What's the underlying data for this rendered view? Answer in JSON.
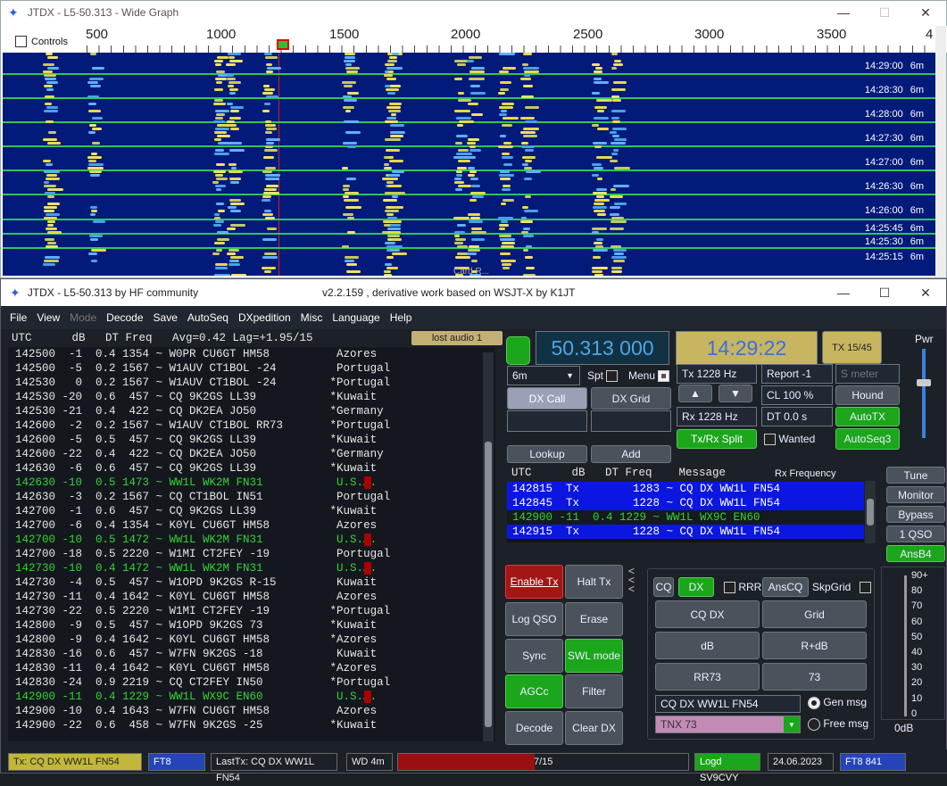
{
  "wide_graph": {
    "title": "JTDX - L5-50.313 - Wide Graph",
    "controls_label": "Controls",
    "ticks": [
      "500",
      "1000",
      "1500",
      "2000",
      "2500",
      "3000",
      "3500",
      "4"
    ],
    "time_labels": [
      {
        "t": "14:29:00",
        "b": "6m"
      },
      {
        "t": "14:28:30",
        "b": "6m"
      },
      {
        "t": "14:28:00",
        "b": "6m"
      },
      {
        "t": "14:27:30",
        "b": "6m"
      },
      {
        "t": "14:27:00",
        "b": "6m"
      },
      {
        "t": "14:26:30",
        "b": "6m"
      },
      {
        "t": "14:26:00",
        "b": "6m"
      },
      {
        "t": "14:25:45",
        "b": "6m"
      },
      {
        "t": "14:25:30",
        "b": "6m"
      },
      {
        "t": "14:25:15",
        "b": "6m"
      }
    ],
    "overlay_text": "Card R..."
  },
  "main": {
    "title": "JTDX - L5-50.313   by HF community",
    "subtitle": "v2.2.159 , derivative work based on WSJT-X by K1JT",
    "menu": [
      "File",
      "View",
      "Mode",
      "Decode",
      "Save",
      "AutoSeq",
      "DXpedition",
      "Misc",
      "Language",
      "Help"
    ],
    "header": "UTC      dB   DT Freq   Avg=0.42 Lag=+1.95/15",
    "lost_audio": "lost audio 1",
    "decodes": [
      {
        "t": "142500  -1  0.4 1354 ~ W0PR CU6GT HM58          Azores",
        "g": false,
        "f": false
      },
      {
        "t": "142500  -5  0.2 1567 ~ W1AUV CT1BOL -24         Portugal",
        "g": false,
        "f": false
      },
      {
        "t": "142530   0  0.2 1567 ~ W1AUV CT1BOL -24        *Portugal",
        "g": false,
        "f": false
      },
      {
        "t": "142530 -20  0.6  457 ~ CQ 9K2GS LL39           *Kuwait",
        "g": false,
        "f": false
      },
      {
        "t": "142530 -21  0.4  422 ~ CQ DK2EA JO50           *Germany",
        "g": false,
        "f": false
      },
      {
        "t": "142600  -2  0.2 1567 ~ W1AUV CT1BOL RR73       *Portugal",
        "g": false,
        "f": false
      },
      {
        "t": "142600  -5  0.5  457 ~ CQ 9K2GS LL39           *Kuwait",
        "g": false,
        "f": false
      },
      {
        "t": "142600 -22  0.4  422 ~ CQ DK2EA JO50           *Germany",
        "g": false,
        "f": false
      },
      {
        "t": "142630  -6  0.6  457 ~ CQ 9K2GS LL39           *Kuwait",
        "g": false,
        "f": false
      },
      {
        "t": "142630 -10  0.5 1473 ~ WW1L WK2M FN31           U.S.A.",
        "g": true,
        "f": true
      },
      {
        "t": "142630  -3  0.2 1567 ~ CQ CT1BOL IN51           Portugal",
        "g": false,
        "f": false
      },
      {
        "t": "142700  -1  0.6  457 ~ CQ 9K2GS LL39           *Kuwait",
        "g": false,
        "f": false
      },
      {
        "t": "142700  -6  0.4 1354 ~ K0YL CU6GT HM58          Azores",
        "g": false,
        "f": false
      },
      {
        "t": "142700 -10  0.5 1472 ~ WW1L WK2M FN31           U.S.A.",
        "g": true,
        "f": true
      },
      {
        "t": "142700 -18  0.5 2220 ~ W1MI CT2FEY -19          Portugal",
        "g": false,
        "f": false
      },
      {
        "t": "142730 -10  0.4 1472 ~ WW1L WK2M FN31           U.S.A.",
        "g": true,
        "f": true
      },
      {
        "t": "142730  -4  0.5  457 ~ W1OPD 9K2GS R-15         Kuwait",
        "g": false,
        "f": false
      },
      {
        "t": "142730 -11  0.4 1642 ~ K0YL CU6GT HM58          Azores",
        "g": false,
        "f": false
      },
      {
        "t": "142730 -22  0.5 2220 ~ W1MI CT2FEY -19         *Portugal",
        "g": false,
        "f": false
      },
      {
        "t": "142800  -9  0.5  457 ~ W1OPD 9K2GS 73          *Kuwait",
        "g": false,
        "f": false
      },
      {
        "t": "142800  -9  0.4 1642 ~ K0YL CU6GT HM58         *Azores",
        "g": false,
        "f": false
      },
      {
        "t": "142830 -16  0.6  457 ~ W7FN 9K2GS -18           Kuwait",
        "g": false,
        "f": false
      },
      {
        "t": "142830 -11  0.4 1642 ~ K0YL CU6GT HM58         *Azores",
        "g": false,
        "f": false
      },
      {
        "t": "142830 -24  0.9 2219 ~ CQ CT2FEY IN50          *Portugal",
        "g": false,
        "f": false
      },
      {
        "t": "142900 -11  0.4 1229 ~ WW1L WX9C EN60           U.S.A.",
        "g": true,
        "f": true
      },
      {
        "t": "142900 -10  0.4 1643 ~ W7FN CU6GT HM58          Azores",
        "g": false,
        "f": false
      },
      {
        "t": "142900 -22  0.6  458 ~ W7FN 9K2GS -25          *Kuwait",
        "g": false,
        "f": false
      }
    ],
    "freq": "50.313 000",
    "clock": "14:29:22",
    "tx_period": "TX 15/45",
    "pwr_label": "Pwr",
    "band": "6m",
    "spt_label": "Spt",
    "menu_label": "Menu",
    "dx_call_btn": "DX Call",
    "dx_grid_btn": "DX Grid",
    "lookup_btn": "Lookup",
    "add_btn": "Add",
    "tx_hz": "Tx  1228  Hz",
    "rx_hz": "Rx  1228  Hz",
    "report": "Report -1",
    "smeter": "S meter",
    "cl": "CL  100 %",
    "dt": "DT 0.0 s",
    "hound": "Hound",
    "autotx": "AutoTX",
    "txrx_split": "Tx/Rx Split",
    "wanted": "Wanted",
    "autoseq3": "AutoSeq3",
    "rx_header": "UTC      dB   DT Freq    Message",
    "rx_freq_label": "Rx Frequency",
    "rx_rows": [
      {
        "t": "142815  Tx        1283 ~ CQ DX WW1L FN54",
        "c": "b"
      },
      {
        "t": "142845  Tx        1228 ~ CQ DX WW1L FN54",
        "c": "b"
      },
      {
        "t": "142900 -11  0.4 1229 ~ WW1L WX9C EN60",
        "c": "g"
      },
      {
        "t": "142915  Tx        1228 ~ CQ DX WW1L FN54",
        "c": "b"
      }
    ],
    "side_btns": [
      "Tune",
      "Monitor",
      "Bypass",
      "1 QSO",
      "AnsB4"
    ],
    "enable_tx": "Enable Tx",
    "halt_tx": "Halt Tx",
    "log_qso": "Log QSO",
    "erase": "Erase",
    "sync": "Sync",
    "swl": "SWL mode",
    "agcc": "AGCc",
    "filter": "Filter",
    "decode": "Decode",
    "clear_dx": "Clear DX",
    "cq": "CQ",
    "dx": "DX",
    "rrr": "RRR",
    "anscq": "AnsCQ",
    "skpgrid": "SkpGrid",
    "msg_btns": [
      "CQ DX",
      "Grid",
      "dB",
      "R+dB",
      "RR73",
      "73"
    ],
    "tx_msg": "CQ DX WW1L FN54",
    "free_msg": "TNX 73",
    "gen_msg": "Gen msg",
    "free_msg_label": "Free msg",
    "meter_ticks": [
      "90+",
      "80",
      "70",
      "60",
      "50",
      "40",
      "30",
      "20",
      "10",
      "0"
    ],
    "meter_unit": "0dB"
  },
  "status": {
    "tx": "Tx: CQ DX WW1L FN54",
    "mode": "FT8",
    "lasttx": "LastTx: CQ DX WW1L FN54",
    "wd": "WD 4m",
    "prog_text": "7/15",
    "progress": 0.47,
    "logd": "Logd SV9CVY",
    "date": "24.06.2023",
    "ft8": "FT8  841"
  }
}
